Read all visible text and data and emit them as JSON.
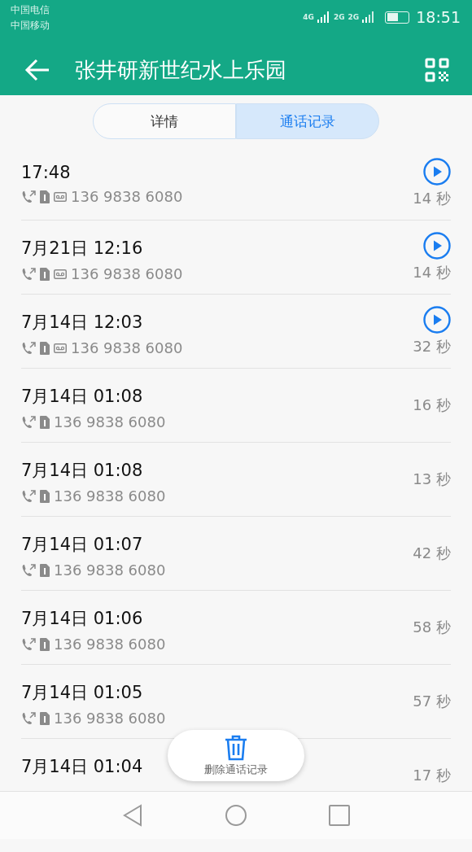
{
  "status_bar": {
    "carriers": [
      "中国电信",
      "中国移动"
    ],
    "network_1": "4G",
    "network_2": "2G",
    "network_3": "2G",
    "time": "18:51"
  },
  "app_bar": {
    "title": "张井研新世纪水上乐园"
  },
  "tabs": [
    {
      "label": "详情",
      "selected": false
    },
    {
      "label": "通话记录",
      "selected": true
    }
  ],
  "calls": [
    {
      "time": "17:48",
      "number": "136 9838 6080",
      "voicemail": true,
      "duration": "14 秒"
    },
    {
      "time": "7月21日 12:16",
      "number": "136 9838 6080",
      "voicemail": true,
      "duration": "14 秒"
    },
    {
      "time": "7月14日 12:03",
      "number": "136 9838 6080",
      "voicemail": true,
      "duration": "32 秒"
    },
    {
      "time": "7月14日 01:08",
      "number": "136 9838 6080",
      "voicemail": false,
      "duration": "16 秒"
    },
    {
      "time": "7月14日 01:08",
      "number": "136 9838 6080",
      "voicemail": false,
      "duration": "13 秒"
    },
    {
      "time": "7月14日 01:07",
      "number": "136 9838 6080",
      "voicemail": false,
      "duration": "42 秒"
    },
    {
      "time": "7月14日 01:06",
      "number": "136 9838 6080",
      "voicemail": false,
      "duration": "58 秒"
    },
    {
      "time": "7月14日 01:05",
      "number": "136 9838 6080",
      "voicemail": false,
      "duration": "57 秒"
    },
    {
      "time": "7月14日 01:04",
      "voicemail": false,
      "duration": "17 秒"
    }
  ],
  "delete_button": {
    "label": "删除通话记录"
  }
}
